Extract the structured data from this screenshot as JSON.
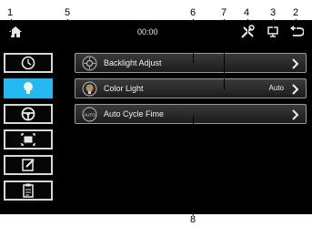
{
  "callouts": [
    "1",
    "5",
    "6",
    "7",
    "4",
    "3",
    "2",
    "8"
  ],
  "status_bar": {
    "time": "00:00"
  },
  "menu": {
    "items": [
      {
        "label": "Backlight Adjust",
        "value": ""
      },
      {
        "label": "Color Light",
        "value": "Auto"
      },
      {
        "label": "Auto Cycle Fime",
        "value": ""
      }
    ],
    "auto_badge": "AUTO"
  },
  "colors": {
    "accent": "#23b8ef",
    "screen_bg": "#000000",
    "item_border": "#9a9a9a"
  }
}
